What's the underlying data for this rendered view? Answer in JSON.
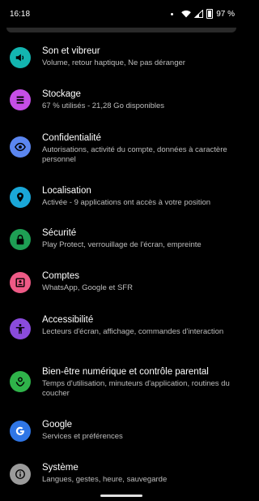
{
  "status_bar": {
    "time": "16:18",
    "battery_text": "97 %"
  },
  "settings_items": [
    {
      "title": "Son et vibreur",
      "subtitle": "Volume, retour haptique, Ne pas déranger",
      "icon": "volume-icon",
      "color": "#13b5b0"
    },
    {
      "title": "Stockage",
      "subtitle": "67 % utilisés - 21,28 Go disponibles",
      "icon": "storage-icon",
      "color": "#c64ee6"
    },
    {
      "title": "Confidentialité",
      "subtitle": "Autorisations, activité du compte, données à caractère personnel",
      "icon": "privacy-eye-icon",
      "color": "#5b86f0"
    },
    {
      "title": "Localisation",
      "subtitle": "Activée - 9 applications ont accès à votre position",
      "icon": "location-icon",
      "color": "#1aa7d8"
    },
    {
      "title": "Sécurité",
      "subtitle": "Play Protect, verrouillage de l'écran, empreinte",
      "icon": "lock-icon",
      "color": "#1e9e54"
    },
    {
      "title": "Comptes",
      "subtitle": "WhatsApp, Google et SFR",
      "icon": "account-icon",
      "color": "#ee5a86"
    },
    {
      "title": "Accessibilité",
      "subtitle": "Lecteurs d'écran, affichage, commandes d'interaction",
      "icon": "accessibility-icon",
      "color": "#8a4bdc"
    },
    {
      "title": "Bien-être numérique et contrôle parental",
      "subtitle": "Temps d'utilisation, minuteurs d'application, routines du coucher",
      "icon": "wellbeing-icon",
      "color": "#2fb34a"
    },
    {
      "title": "Google",
      "subtitle": "Services et préférences",
      "icon": "google-icon",
      "color": "#2f76e6"
    },
    {
      "title": "Système",
      "subtitle": "Langues, gestes, heure, sauvegarde",
      "icon": "info-icon",
      "color": "#9b9b9b"
    }
  ]
}
